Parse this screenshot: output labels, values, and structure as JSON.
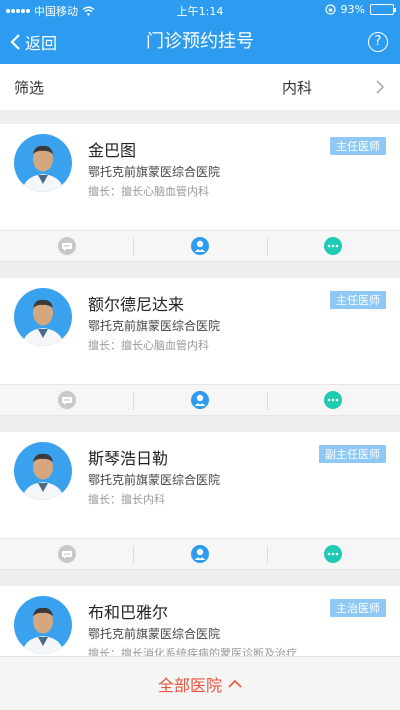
{
  "status_bar": {
    "carrier": "中国移动",
    "time": "上午1:14",
    "battery": "93%",
    "battery_level": 0.93
  },
  "nav": {
    "back_label": "返回",
    "title": "门诊预约挂号",
    "help_label": "?"
  },
  "filter": {
    "label": "筛选",
    "value": "内科"
  },
  "doctors": [
    {
      "name": "金巴图",
      "title": "主任医师",
      "hospital": "鄂托克前旗蒙医综合医院",
      "specialty": "擅长：擅长心脑血管内科"
    },
    {
      "name": "额尔德尼达来",
      "title": "主任医师",
      "hospital": "鄂托克前旗蒙医综合医院",
      "specialty": "擅长：擅长心脑血管内科"
    },
    {
      "name": "斯琴浩日勒",
      "title": "副主任医师",
      "hospital": "鄂托克前旗蒙医综合医院",
      "specialty": "擅长：擅长内科"
    },
    {
      "name": "布和巴雅尔",
      "title": "主治医师",
      "hospital": "鄂托克前旗蒙医综合医院",
      "specialty": "擅长：擅长消化系统疾病的蒙医诊断及治疗"
    }
  ],
  "footer": {
    "label": "全部医院"
  },
  "colors": {
    "primary": "#2d9cf0",
    "badge": "#8fc8f5",
    "accent": "#e9573f",
    "teal": "#1fcbb4"
  }
}
